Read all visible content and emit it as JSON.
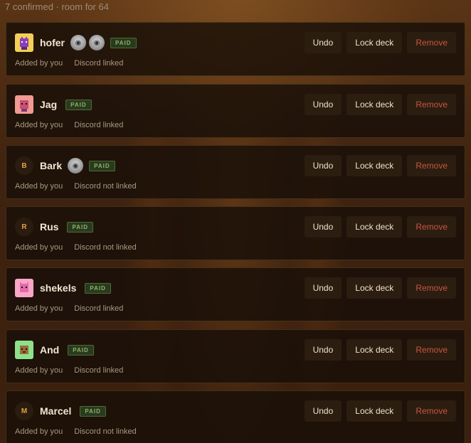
{
  "header": {
    "summary": "7 confirmed · room for 64"
  },
  "buttons": {
    "undo": "Undo",
    "lock": "Lock deck",
    "remove": "Remove"
  },
  "badge": {
    "paid": "PAID"
  },
  "players": [
    {
      "name": "hofer",
      "avatar": "pixel-purple-creature-icon",
      "avatar_letter": "",
      "mini_avatars": 2,
      "added_by": "Added by you",
      "discord": "Discord linked"
    },
    {
      "name": "Jag",
      "avatar": "pixel-pink-creature-icon",
      "avatar_letter": "",
      "mini_avatars": 0,
      "added_by": "Added by you",
      "discord": "Discord linked"
    },
    {
      "name": "Bark",
      "avatar": "letter-avatar",
      "avatar_letter": "B",
      "mini_avatars": 1,
      "added_by": "Added by you",
      "discord": "Discord not linked"
    },
    {
      "name": "Rus",
      "avatar": "letter-avatar",
      "avatar_letter": "R",
      "mini_avatars": 0,
      "added_by": "Added by you",
      "discord": "Discord not linked"
    },
    {
      "name": "shekels",
      "avatar": "pixel-pink-cat-icon",
      "avatar_letter": "",
      "mini_avatars": 0,
      "added_by": "Added by you",
      "discord": "Discord linked"
    },
    {
      "name": "And",
      "avatar": "pixel-green-dog-icon",
      "avatar_letter": "",
      "mini_avatars": 0,
      "added_by": "Added by you",
      "discord": "Discord linked"
    },
    {
      "name": "Marcel",
      "avatar": "letter-avatar",
      "avatar_letter": "M",
      "mini_avatars": 0,
      "added_by": "Added by you",
      "discord": "Discord not linked"
    }
  ],
  "colors": {
    "paid_text": "#8fb06a",
    "remove_text": "#c8553f",
    "letter_avatar_text": "#e0a04a"
  }
}
